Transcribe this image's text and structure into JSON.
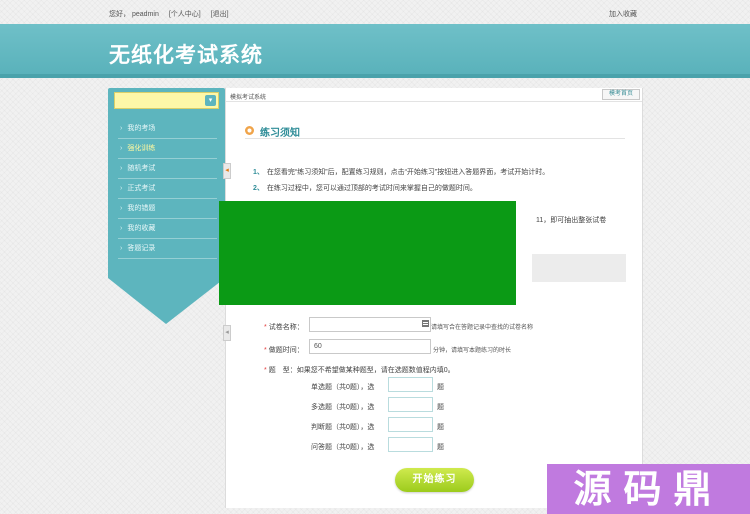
{
  "topbar": {
    "greeting": "您好，",
    "username": "peadmin",
    "personal_center": "[个人中心]",
    "logout": "[退出]",
    "add_favorite": "加入收藏"
  },
  "banner": {
    "title": "无纸化考试系统"
  },
  "sidebar": {
    "select_value": "",
    "items": [
      {
        "label": "我的考场"
      },
      {
        "label": "强化训练"
      },
      {
        "label": "随机考试"
      },
      {
        "label": "正式考试"
      },
      {
        "label": "我的错题"
      },
      {
        "label": "我的收藏"
      },
      {
        "label": "答题记录"
      }
    ],
    "active_index": 1
  },
  "main": {
    "breadcrumb": "模拟考试系统",
    "home_button": "模考首页",
    "section_title": "练习须知",
    "notes": [
      {
        "num": "1、",
        "text": "在您看完“练习须知”后，配置练习规则，点击“开始练习”按钮进入答题界面，考试开始计时。"
      },
      {
        "num": "2、",
        "text": "在练习过程中，您可以通过顶部的考试时间来掌握自己的做题时间。"
      },
      {
        "num": "",
        "text": "11，即可抽出整张试卷"
      }
    ],
    "form": {
      "paper_name_label": "试卷名称：",
      "paper_name_value": "",
      "paper_name_hint": "请填写合在答题记录中查找的试卷名称",
      "time_label": "做题时间：",
      "time_value": "60",
      "time_hint": "分钟，请填写本题练习的时长",
      "type_label": "题　型：",
      "type_hint": "如果您不希望做某种题型，请在选题数值程内填0。",
      "question_types": [
        {
          "label": "单选题（共0题），选",
          "unit": "题"
        },
        {
          "label": "多选题（共0题），选",
          "unit": "题"
        },
        {
          "label": "判断题（共0题），选",
          "unit": "题"
        },
        {
          "label": "问答题（共0题），选",
          "unit": "题"
        }
      ]
    },
    "start_button": "开始练习"
  },
  "watermark": {
    "text": "源码鼎"
  },
  "colors": {
    "banner": "#5ab2bb",
    "sidebar": "#5db5be",
    "accent_title": "#2f8d98",
    "start_button": "#9ccb1c",
    "overlay_green": "#0b9a15",
    "watermark": "#c07adf"
  }
}
